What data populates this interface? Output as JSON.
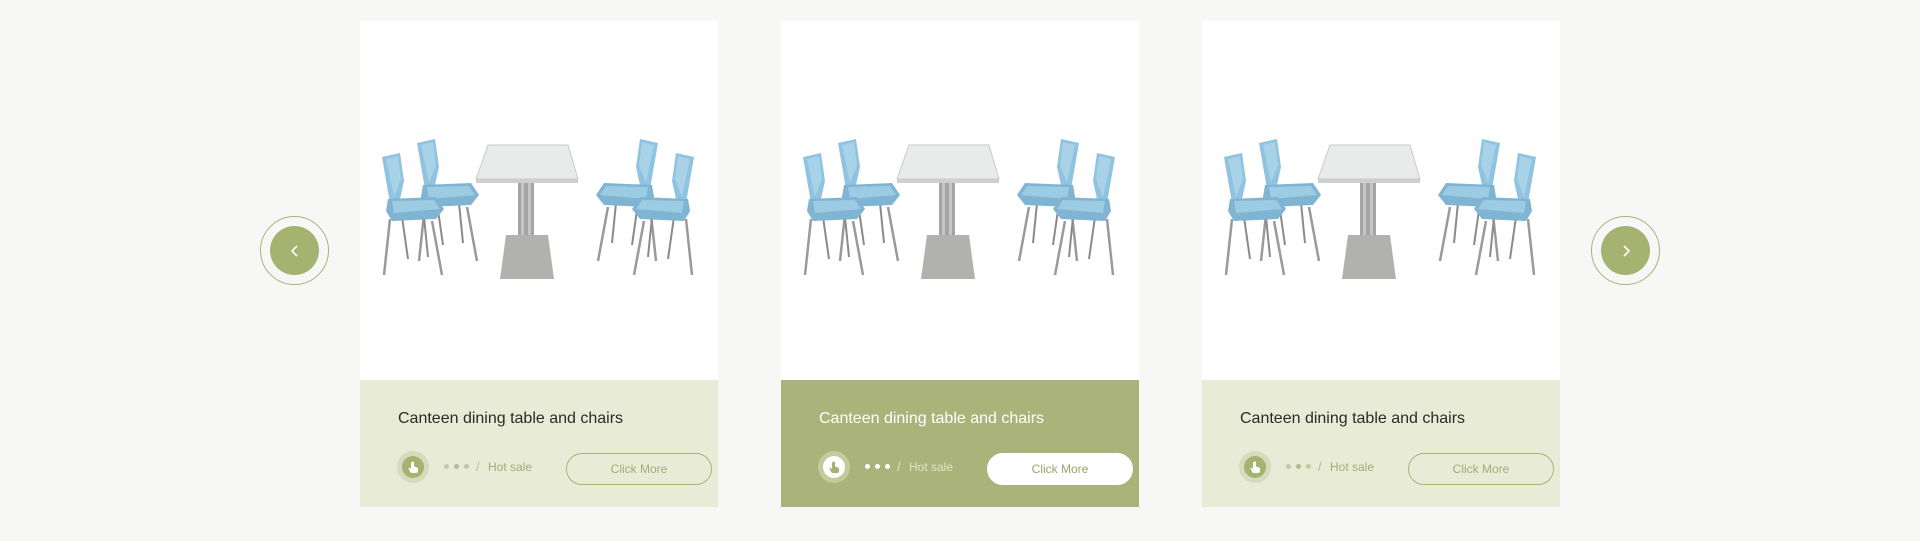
{
  "carousel": {
    "prev_icon": "chevron-left-icon",
    "next_icon": "chevron-right-icon",
    "cards": [
      {
        "title": "Canteen dining table and chairs",
        "tag": "Hot sale",
        "separator": "/",
        "button": "Click More",
        "active": false
      },
      {
        "title": "Canteen dining table and chairs",
        "tag": "Hot sale",
        "separator": "/",
        "button": "Click More",
        "active": true
      },
      {
        "title": "Canteen dining table and chairs",
        "tag": "Hot sale",
        "separator": "/",
        "button": "Click More",
        "active": false
      }
    ]
  },
  "colors": {
    "accent": "#a6b26f",
    "card_info_bg": "#e8ebd6",
    "card_info_active_bg": "#a9b37a",
    "page_bg": "#f7f7f5",
    "chair_blue": "#8fc3df"
  }
}
